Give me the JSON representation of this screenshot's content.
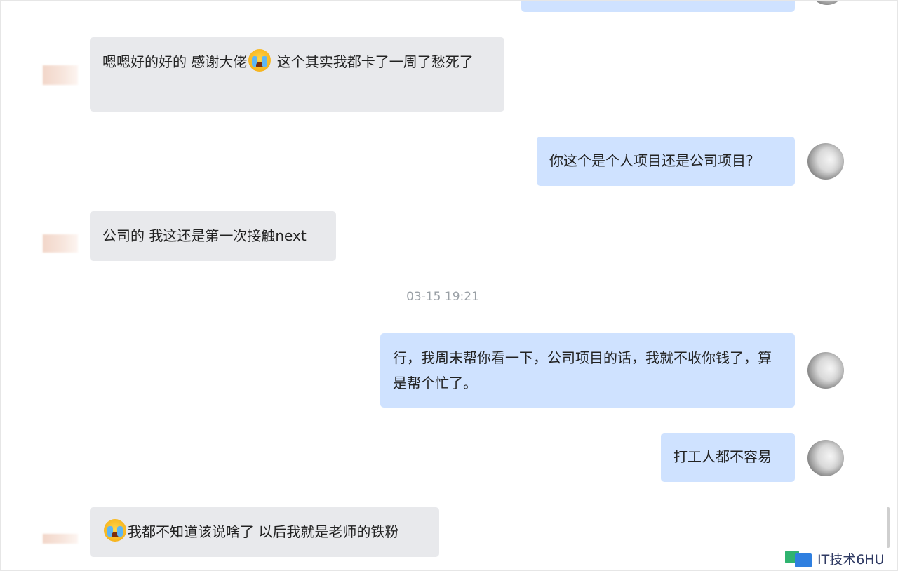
{
  "messages": [
    {
      "side": "in",
      "text": "嗯嗯好的好的 感谢大佬",
      "text_after_emoji": " 这个其实我都卡了一周了愁死了",
      "emoji": "crying-face"
    },
    {
      "side": "out",
      "text": "你这个是个人项目还是公司项目?"
    },
    {
      "side": "in",
      "text": "公司的 我这还是第一次接触next"
    },
    {
      "side": "out",
      "text": "行，我周末帮你看一下，公司项目的话，我就不收你钱了，算是帮个忙了。"
    },
    {
      "side": "out",
      "text": "打工人都不容易"
    },
    {
      "side": "in",
      "text_after_emoji": "我都不知道该说啥了 以后我就是老师的铁粉",
      "emoji": "crying-face"
    }
  ],
  "timestamp": "03-15 19:21",
  "watermark": {
    "text": "IT技术6HU"
  },
  "colors": {
    "incoming_bubble": "#e8e9ec",
    "outgoing_bubble": "#cfe2ff",
    "timestamp": "#9aa0a6"
  }
}
